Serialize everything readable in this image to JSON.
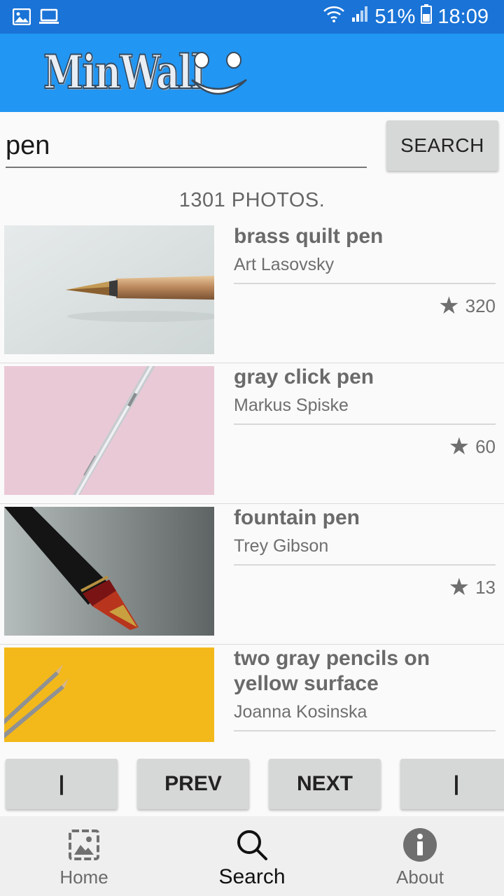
{
  "status_bar": {
    "battery": "51%",
    "time": "18:09",
    "icons": [
      "gallery-notification-icon",
      "screen-notification-icon",
      "wifi-icon",
      "signal-icon",
      "battery-icon"
    ]
  },
  "app_bar": {
    "logo_text": "MinWall",
    "brand_color": "#2196f3"
  },
  "search": {
    "value": "pen",
    "button_label": "SEARCH"
  },
  "results_count": "1301 PHOTOS.",
  "results": [
    {
      "title": "brass quilt pen",
      "author": "Art Lasovsky",
      "likes": "320"
    },
    {
      "title": "gray click pen",
      "author": "Markus Spiske",
      "likes": "60"
    },
    {
      "title": "fountain pen",
      "author": "Trey Gibson",
      "likes": "13"
    },
    {
      "title": "two gray pencils on yellow surface",
      "author": "Joanna Kosinska",
      "likes": ""
    }
  ],
  "pager": {
    "first": "|",
    "prev": "PREV",
    "next": "NEXT",
    "last": "|"
  },
  "bottom_nav": [
    {
      "label": "Home",
      "icon": "image-icon"
    },
    {
      "label": "Search",
      "icon": "search-icon",
      "active": true
    },
    {
      "label": "About",
      "icon": "info-icon"
    }
  ]
}
